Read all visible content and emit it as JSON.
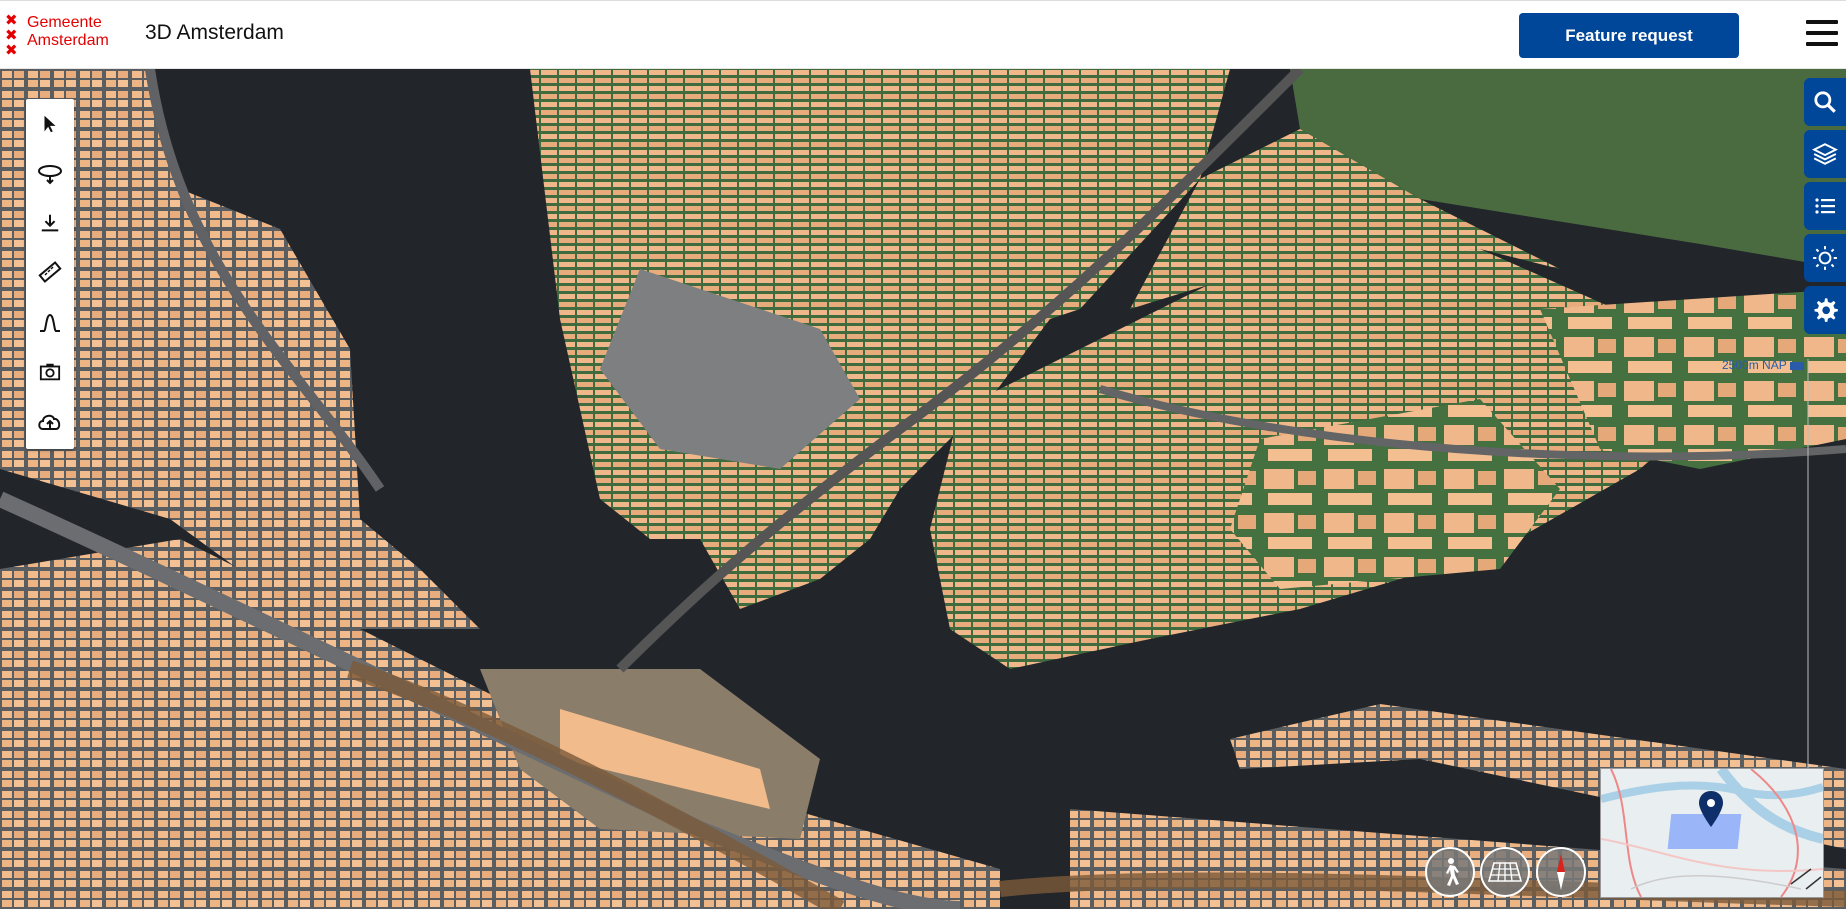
{
  "header": {
    "logo_text_line1": "Gemeente",
    "logo_text_line2": "Amsterdam",
    "app_title": "3D Amsterdam",
    "feature_request_label": "Feature request"
  },
  "toolbar": {
    "tools": [
      "select-tool",
      "lasso-tool",
      "download-tool",
      "measure-tool",
      "profile-tool",
      "screenshot-tool",
      "upload-tool"
    ]
  },
  "right_panel": {
    "buttons": [
      "search-icon",
      "layers-icon",
      "list-icon",
      "sun-icon",
      "gear-icon"
    ]
  },
  "scale": {
    "nap_label": "2500m NAP"
  },
  "navigation": {
    "buttons": [
      "walk-icon",
      "grid-icon",
      "compass-icon"
    ]
  },
  "colors": {
    "brand_red": "#e50000",
    "brand_blue": "#004699",
    "water": "#22252a",
    "building": "#f0b88a",
    "green": "#3f6b3e",
    "road": "#6a6d70"
  }
}
